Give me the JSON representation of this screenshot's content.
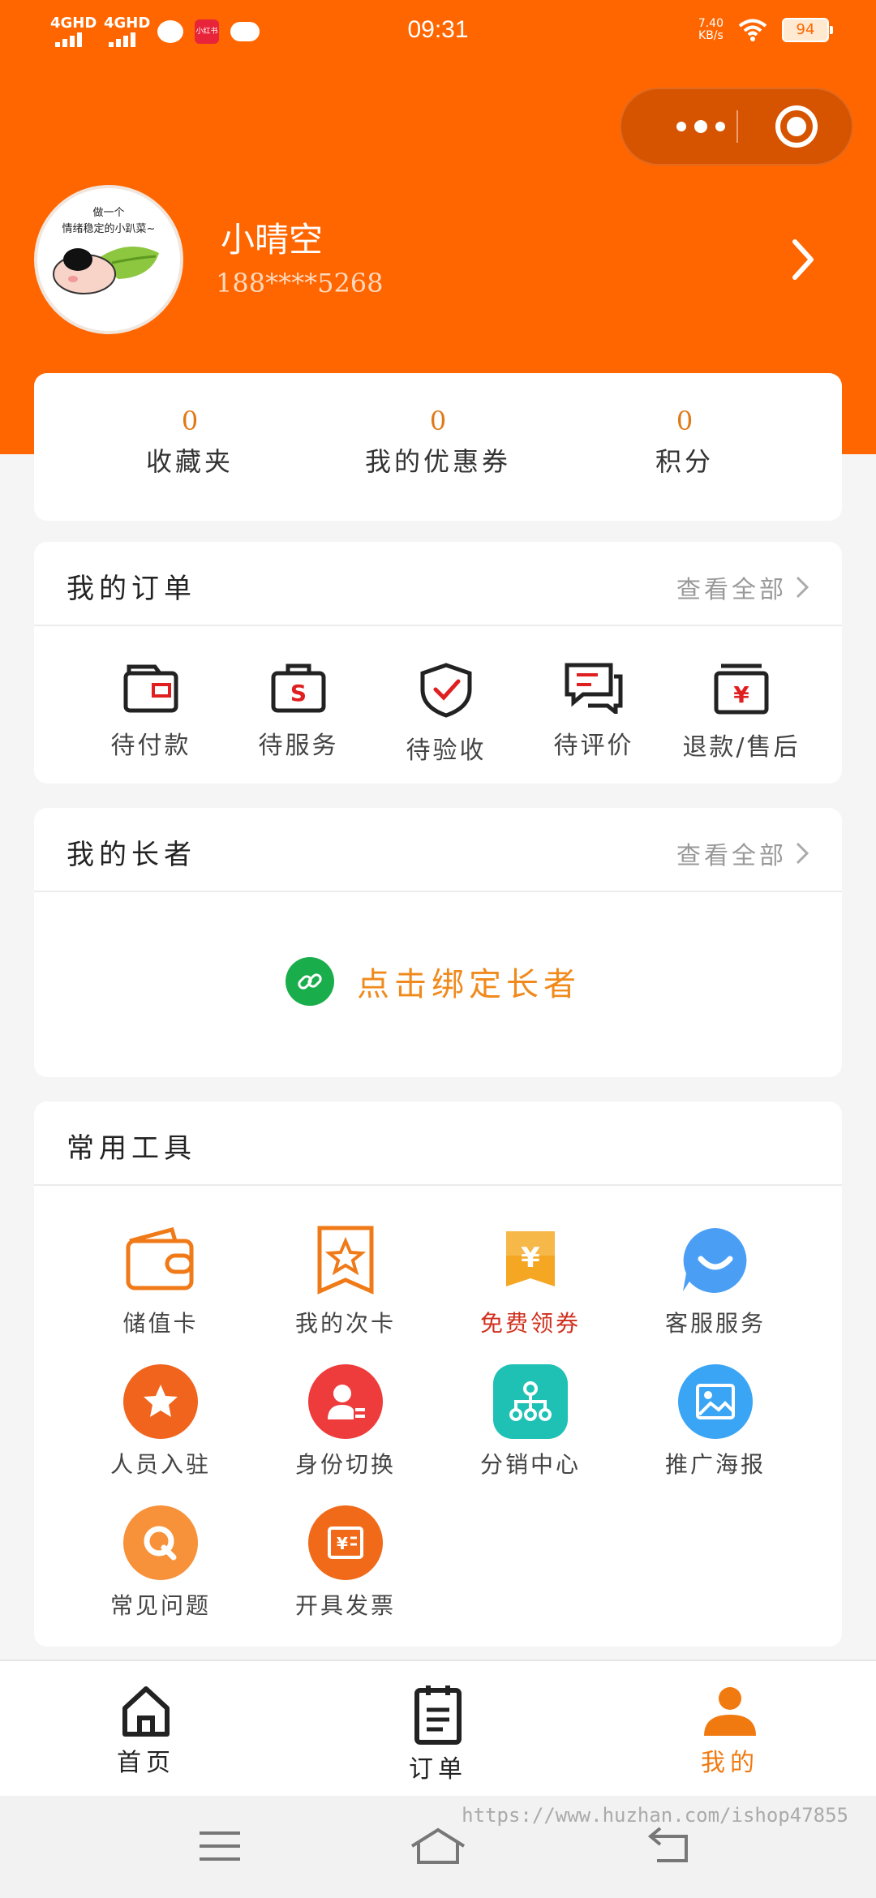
{
  "status_bar": {
    "network1": "4GHD",
    "network2": "4GHD",
    "red_app_label": "小红书",
    "time": "09:31",
    "speed_value": "7.40",
    "speed_unit": "KB/s",
    "battery": "94"
  },
  "profile": {
    "username": "小晴空",
    "phone": "188****5268",
    "avatar_caption_line1": "做一个",
    "avatar_caption_line2": "情绪稳定的小趴菜~"
  },
  "stats": [
    {
      "value": "0",
      "label": "收藏夹"
    },
    {
      "value": "0",
      "label": "我的优惠券"
    },
    {
      "value": "0",
      "label": "积分"
    }
  ],
  "orders": {
    "title": "我的订单",
    "more": "查看全部",
    "items": [
      {
        "label": "待付款",
        "icon": "wallet-icon"
      },
      {
        "label": "待服务",
        "icon": "bag-icon"
      },
      {
        "label": "待验收",
        "icon": "shield-check-icon"
      },
      {
        "label": "待评价",
        "icon": "comment-icon"
      },
      {
        "label": "退款/售后",
        "icon": "refund-icon"
      }
    ]
  },
  "elders": {
    "title": "我的长者",
    "more": "查看全部",
    "bind_text": "点击绑定长者"
  },
  "tools": {
    "title": "常用工具",
    "items": [
      {
        "label": "储值卡",
        "icon": "wallet-icon"
      },
      {
        "label": "我的次卡",
        "icon": "star-card-icon"
      },
      {
        "label": "免费领券",
        "icon": "coupon-icon"
      },
      {
        "label": "客服服务",
        "icon": "customer-service-icon"
      },
      {
        "label": "人员入驻",
        "icon": "star-icon"
      },
      {
        "label": "身份切换",
        "icon": "user-switch-icon"
      },
      {
        "label": "分销中心",
        "icon": "distribution-icon"
      },
      {
        "label": "推广海报",
        "icon": "image-icon"
      },
      {
        "label": "常见问题",
        "icon": "faq-icon"
      },
      {
        "label": "开具发票",
        "icon": "invoice-icon"
      }
    ]
  },
  "tabbar": [
    {
      "label": "首页",
      "icon": "home-icon"
    },
    {
      "label": "订单",
      "icon": "order-list-icon"
    },
    {
      "label": "我的",
      "icon": "user-icon"
    }
  ],
  "watermark": "https://www.huzhan.com/ishop47855",
  "colors": {
    "brand": "#ff6600",
    "accent_text": "#f08a1c",
    "tab_active": "#f07a10",
    "coupon_label": "#d0301e"
  }
}
